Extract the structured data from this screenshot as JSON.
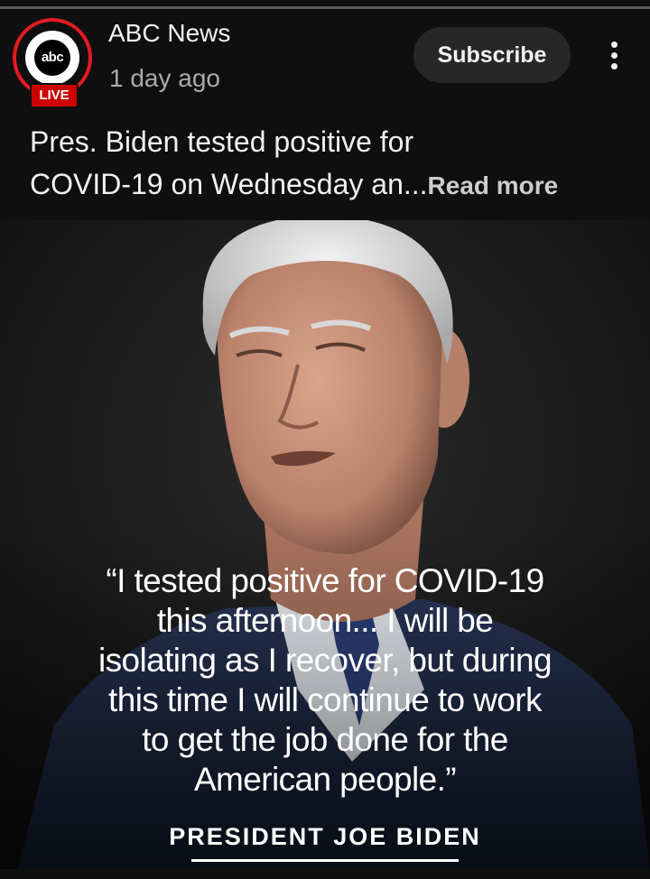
{
  "post": {
    "channel_name": "ABC News",
    "avatar_logo_text": "abc",
    "live_badge": "LIVE",
    "time_ago": "1 day ago",
    "subscribe_label": "Subscribe",
    "caption_line1": "Pres. Biden tested positive for",
    "caption_line2": "COVID-19 on Wednesday an...",
    "read_more": "Read more"
  },
  "image": {
    "quote_lines": [
      "“I tested positive for COVID-19",
      "this afternoon... I will be",
      "isolating as I recover, but during",
      "this time I will continue to work",
      "to get the job done for the",
      "American people.”"
    ],
    "attribution": "PRESIDENT JOE BIDEN"
  },
  "icons": {
    "more": "more-vertical-icon"
  },
  "colors": {
    "background": "#0f0f0f",
    "live_red": "#cc0000",
    "ring_red": "#e31b23",
    "subscribe_bg": "#272727",
    "suit_navy": "#1f2a44"
  }
}
